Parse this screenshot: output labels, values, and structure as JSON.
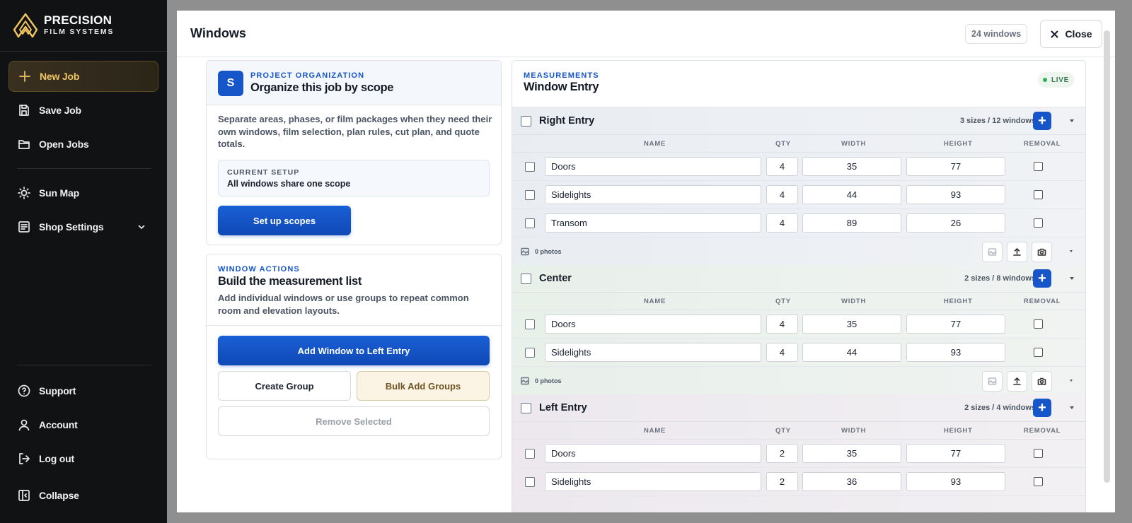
{
  "brand": {
    "line1": "PRECISION",
    "line2": "FILM SYSTEMS",
    "accent": "#f1c561"
  },
  "sidebar": {
    "new_job": "New Job",
    "save_job": "Save Job",
    "open_jobs": "Open Jobs",
    "sun_map": "Sun Map",
    "shop_settings": "Shop Settings",
    "support": "Support",
    "account": "Account",
    "log_out": "Log out",
    "collapse": "Collapse"
  },
  "modal": {
    "title": "Windows",
    "count_badge": "24 windows",
    "close_label": "Close"
  },
  "scope_card": {
    "badge": "S",
    "eyebrow": "PROJECT ORGANIZATION",
    "title": "Organize this job by scope",
    "description": "Separate areas, phases, or film packages when they need their own windows, film selection, plan rules, cut plan, and quote totals.",
    "setup_label": "CURRENT SETUP",
    "setup_value": "All windows share one scope",
    "button": "Set up scopes"
  },
  "actions_card": {
    "eyebrow": "WINDOW ACTIONS",
    "title": "Build the measurement list",
    "description": "Add individual windows or use groups to repeat common room and elevation layouts.",
    "add_window": "Add Window to Left Entry",
    "create_group": "Create Group",
    "bulk_add": "Bulk Add Groups",
    "remove_selected": "Remove Selected"
  },
  "measurements": {
    "eyebrow": "MEASUREMENTS",
    "title": "Window Entry",
    "live": "LIVE",
    "columns": {
      "name": "NAME",
      "qty": "QTY",
      "width": "WIDTH",
      "height": "HEIGHT",
      "removal": "REMOVAL"
    },
    "groups": [
      {
        "name": "Right Entry",
        "summary": "3 sizes / 12 windows",
        "photos": "0 photos",
        "rows": [
          {
            "name": "Doors",
            "qty": "4",
            "width": "35",
            "height": "77"
          },
          {
            "name": "Sidelights",
            "qty": "4",
            "width": "44",
            "height": "93"
          },
          {
            "name": "Transom",
            "qty": "4",
            "width": "89",
            "height": "26"
          }
        ]
      },
      {
        "name": "Center",
        "summary": "2 sizes / 8 windows",
        "photos": "0 photos",
        "rows": [
          {
            "name": "Doors",
            "qty": "4",
            "width": "35",
            "height": "77"
          },
          {
            "name": "Sidelights",
            "qty": "4",
            "width": "44",
            "height": "93"
          }
        ]
      },
      {
        "name": "Left Entry",
        "summary": "2 sizes / 4 windows",
        "rows": [
          {
            "name": "Doors",
            "qty": "2",
            "width": "35",
            "height": "77"
          },
          {
            "name": "Sidelights",
            "qty": "2",
            "width": "36",
            "height": "93"
          }
        ]
      }
    ]
  }
}
